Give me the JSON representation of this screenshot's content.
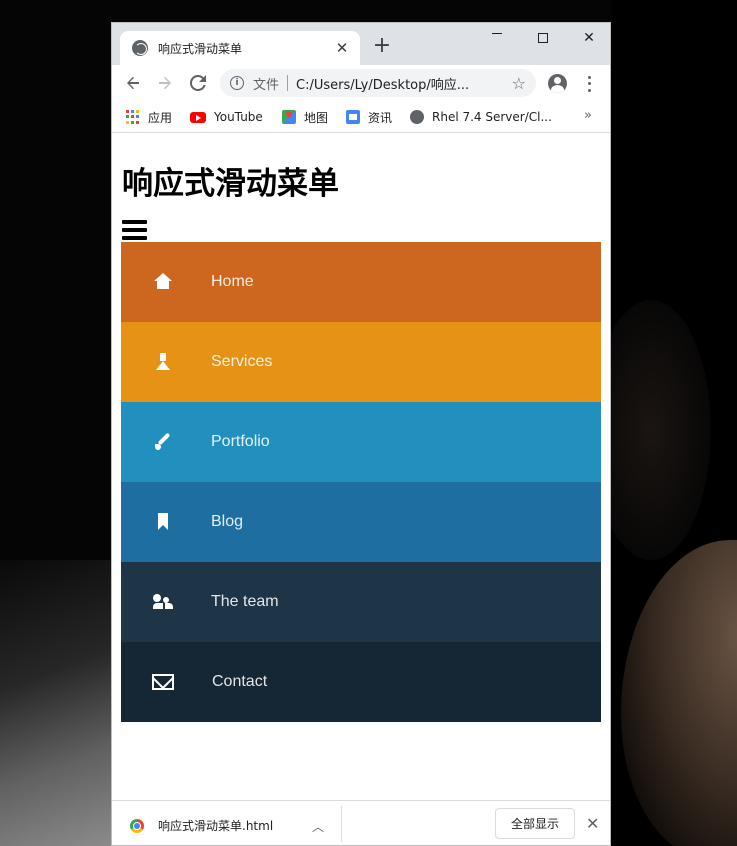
{
  "browser": {
    "tab_title": "响应式滑动菜单",
    "tab_close": "✕",
    "new_tab": "+",
    "window_close": "✕",
    "omnibox": {
      "scheme_label": "文件",
      "url": "C:/Users/Ly/Desktop/响应..."
    }
  },
  "bookmarks": {
    "items": [
      {
        "label": "应用",
        "icon": "apps-grid-icon"
      },
      {
        "label": "YouTube",
        "icon": "youtube-icon"
      },
      {
        "label": "地图",
        "icon": "maps-icon"
      },
      {
        "label": "资讯",
        "icon": "news-icon"
      },
      {
        "label": "Rhel 7.4 Server/Cl...",
        "icon": "globe-icon"
      }
    ],
    "more": "»"
  },
  "page": {
    "heading": "响应式滑动菜单",
    "menu_toggle_icon": "hamburger-icon",
    "nav": [
      {
        "label": "Home",
        "icon": "home-icon",
        "color": "#cd661e"
      },
      {
        "label": "Services",
        "icon": "flask-icon",
        "color": "#e69215"
      },
      {
        "label": "Portfolio",
        "icon": "brush-icon",
        "color": "#2290bf"
      },
      {
        "label": "Blog",
        "icon": "bookmark-icon",
        "color": "#1e6ea1"
      },
      {
        "label": "The team",
        "icon": "team-icon",
        "color": "#1e3547"
      },
      {
        "label": "Contact",
        "icon": "mail-icon",
        "color": "#152634"
      }
    ]
  },
  "downloads": {
    "file_name": "响应式滑动菜单.html",
    "caret": "︿",
    "show_all_label": "全部显示",
    "close": "✕"
  }
}
